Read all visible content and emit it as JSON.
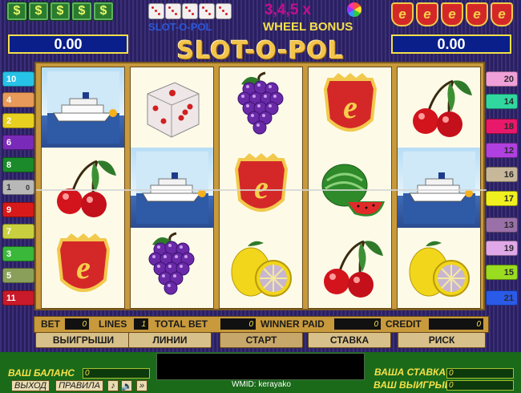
{
  "header": {
    "money_icon_glyph": "$",
    "logo_small": "SLOT-O-POL",
    "wheel_multipliers": "3,4,5 x",
    "wheel_bonus": "WHEEL BONUS",
    "e_letter": "e",
    "left_value": "0.00",
    "right_value": "0.00",
    "title": "SLOT-O-POL"
  },
  "reels": [
    [
      "ship",
      "cherries",
      "e-badge"
    ],
    [
      "dice",
      "ship",
      "grapes"
    ],
    [
      "grapes",
      "e-badge",
      "lemon"
    ],
    [
      "e-badge",
      "watermelon",
      "cherries"
    ],
    [
      "cherries",
      "ship",
      "lemon"
    ]
  ],
  "lines_left": [
    {
      "label": "10",
      "color": "#27c2e8"
    },
    {
      "label": "4",
      "color": "#e89a5a"
    },
    {
      "label": "2",
      "color": "#e8d020"
    },
    {
      "label": "6",
      "color": "#7a2ab8"
    },
    {
      "label": "8",
      "color": "#1a8a2a"
    },
    {
      "label": "1",
      "color": "#b8b8b8"
    },
    {
      "label": "9",
      "color": "#d81a1a"
    },
    {
      "label": "7",
      "color": "#c8d040"
    },
    {
      "label": "3",
      "color": "#3ab83a"
    },
    {
      "label": "5",
      "color": "#8aa05a"
    },
    {
      "label": "11",
      "color": "#c81a2a"
    }
  ],
  "line1_value": "0",
  "lines_right": [
    {
      "label": "20",
      "color": "#f0a0d8"
    },
    {
      "label": "14",
      "color": "#30d8a0"
    },
    {
      "label": "18",
      "color": "#e8186a"
    },
    {
      "label": "12",
      "color": "#b040e0"
    },
    {
      "label": "16",
      "color": "#c8b89a"
    },
    {
      "label": "17",
      "color": "#f0f020"
    },
    {
      "label": "13",
      "color": "#9a70a8"
    },
    {
      "label": "19",
      "color": "#e0a8e8"
    },
    {
      "label": "15",
      "color": "#9adc20"
    },
    {
      "label": "21",
      "color": "#2a5ae8"
    }
  ],
  "infobar": {
    "bet_label": "BET",
    "bet_value": "0",
    "lines_label": "LINES",
    "lines_value": "1",
    "total_bet_label": "TOTAL BET",
    "total_bet_value": "0",
    "winner_paid_label": "WINNER PAID",
    "winner_paid_value": "0",
    "credit_label": "CREDIT",
    "credit_value": "0"
  },
  "buttons": {
    "wins": "ВЫИГРЫШИ",
    "lines": "ЛИНИИ",
    "start": "СТАРТ",
    "bet": "СТАВКА",
    "risk": "РИСК"
  },
  "bottom": {
    "balance_label": "ВАШ БАЛАНС",
    "balance_value": "0",
    "exit": "ВЫХОД",
    "rules": "ПРАВИЛА",
    "music_icon": "♪",
    "sound_icon": "🔈",
    "fast_icon": "»",
    "wmid": "WMID: kerayako",
    "your_bet_label": "ВАША СТАВКА",
    "your_bet_value": "0",
    "your_win_label": "ВАШ  ВЫИГРЫШ",
    "your_win_value": "0"
  },
  "colors": {
    "gold_frame": "#c89a3c",
    "value_box_bg": "#0a1f8a",
    "value_box_border": "#f5e04a",
    "bottom_green": "#1a6a1a"
  }
}
